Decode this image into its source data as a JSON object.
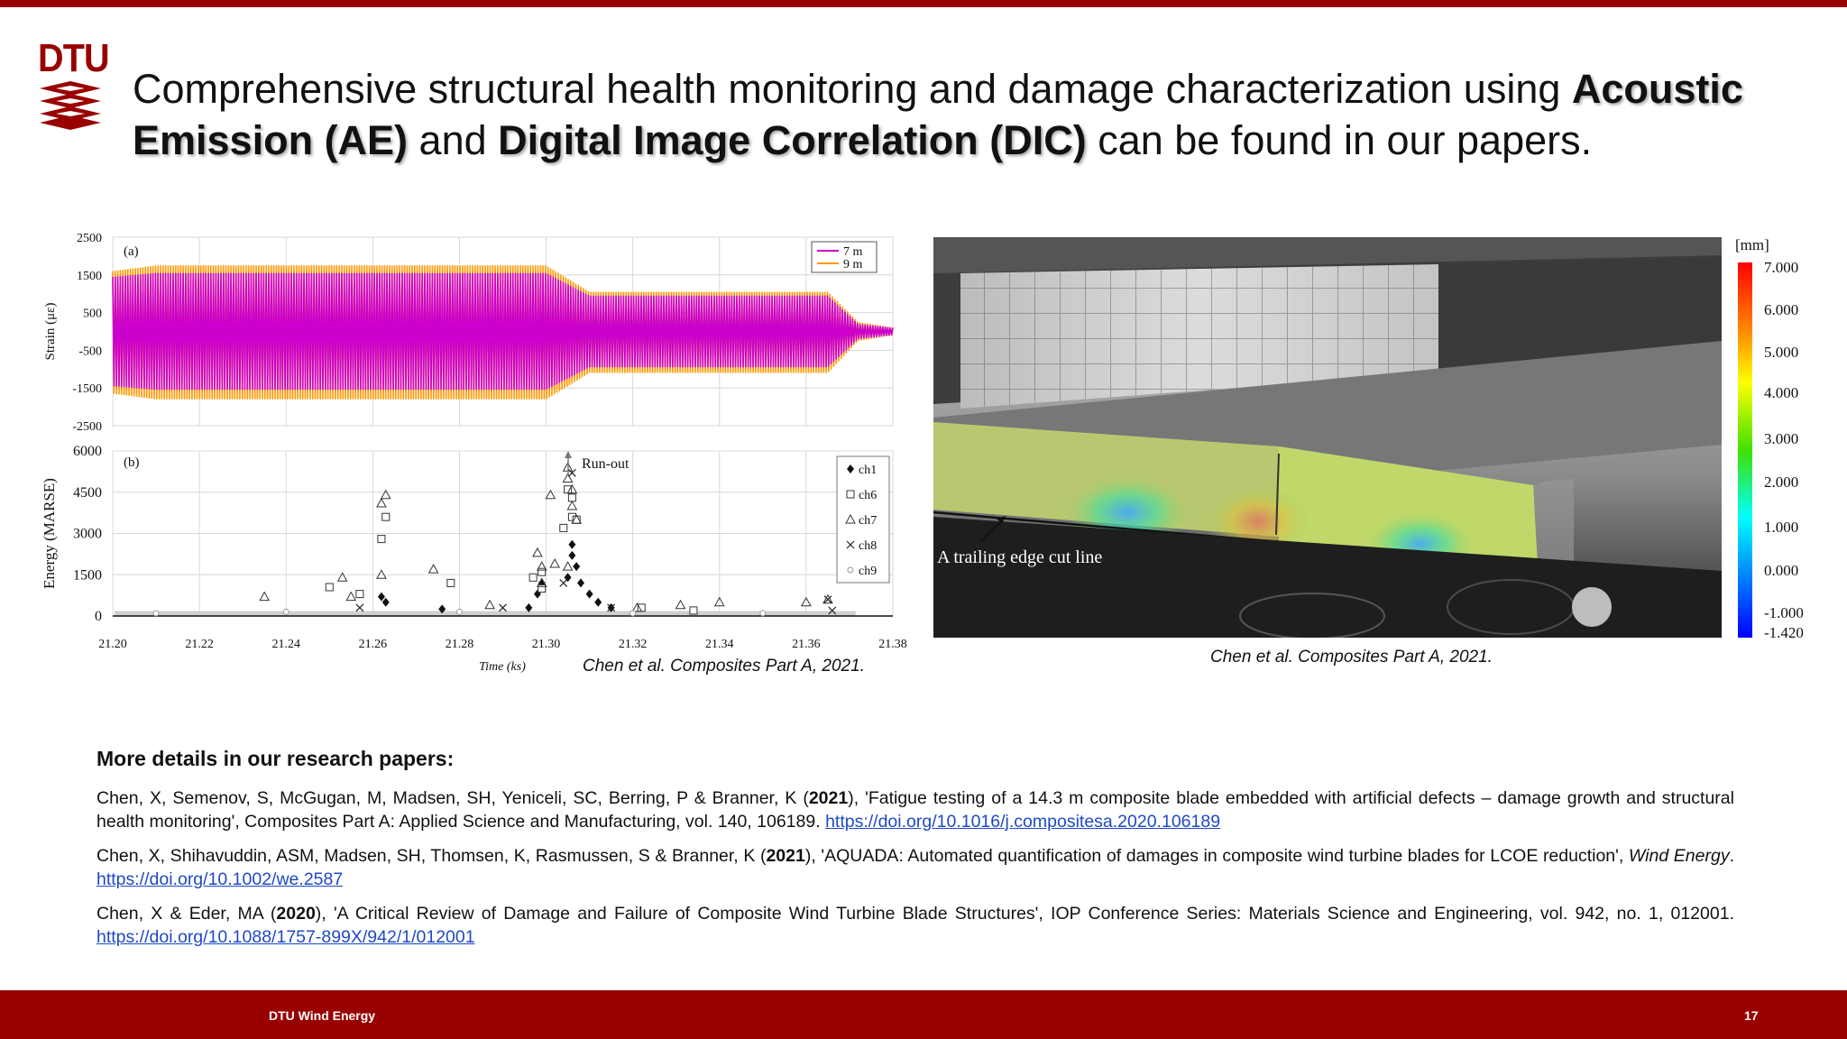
{
  "logo": {
    "text": "DTU"
  },
  "headline": {
    "part1": "Comprehensive structural health monitoring and damage characterization using ",
    "bold1": "Acoustic Emission (AE)",
    "part2": " and ",
    "bold2": "Digital Image Correlation (DIC)",
    "part3": " can be found in our papers."
  },
  "chart_data": [
    {
      "type": "area",
      "panel_label": "(a)",
      "xlabel": "",
      "ylabel": "Strain (με)",
      "ylim": [
        -2500,
        2500
      ],
      "y_ticks": [
        "2500",
        "1500",
        "500",
        "-500",
        "-1500",
        "-2500"
      ],
      "xlim": [
        21.2,
        21.38
      ],
      "grid": true,
      "legend": {
        "position": "top-right",
        "entries": [
          "7 m",
          "9 m"
        ]
      },
      "series": [
        {
          "name": "7 m",
          "color": "#cc00cc",
          "envelope": {
            "x": [
              21.2,
              21.21,
              21.3,
              21.31,
              21.365,
              21.372,
              21.38
            ],
            "ymax": [
              1450,
              1550,
              1550,
              950,
              950,
              200,
              100
            ],
            "ymin": [
              -1450,
              -1550,
              -1550,
              -950,
              -950,
              -200,
              -100
            ]
          }
        },
        {
          "name": "9 m",
          "color": "#ff9900",
          "envelope": {
            "x": [
              21.2,
              21.21,
              21.3,
              21.31,
              21.365,
              21.372,
              21.38
            ],
            "ymax": [
              1600,
              1750,
              1750,
              1050,
              1050,
              250,
              100
            ],
            "ymin": [
              -1650,
              -1800,
              -1800,
              -1100,
              -1100,
              -250,
              -100
            ]
          }
        }
      ]
    },
    {
      "type": "scatter",
      "panel_label": "(b)",
      "xlabel": "Time (ks)",
      "ylabel": "Energy (MARSE)",
      "ylim": [
        0,
        6000
      ],
      "y_ticks": [
        "6000",
        "4500",
        "3000",
        "1500",
        "0"
      ],
      "xlim": [
        21.2,
        21.38
      ],
      "x_ticks": [
        "21.20",
        "21.22",
        "21.24",
        "21.26",
        "21.28",
        "21.30",
        "21.32",
        "21.34",
        "21.36",
        "21.38"
      ],
      "grid": true,
      "annotation": "Run-out",
      "legend": {
        "position": "top-right",
        "entries": [
          "ch1",
          "ch6",
          "ch7",
          "ch8",
          "ch9"
        ]
      },
      "series": [
        {
          "name": "ch1",
          "marker": "filled-diamond",
          "points": [
            [
              21.262,
              700
            ],
            [
              21.263,
              500
            ],
            [
              21.276,
              250
            ],
            [
              21.296,
              300
            ],
            [
              21.298,
              800
            ],
            [
              21.299,
              1200
            ],
            [
              21.306,
              2600
            ],
            [
              21.306,
              2200
            ],
            [
              21.307,
              1800
            ],
            [
              21.305,
              1400
            ],
            [
              21.308,
              1200
            ],
            [
              21.31,
              800
            ],
            [
              21.312,
              500
            ],
            [
              21.315,
              300
            ]
          ]
        },
        {
          "name": "ch6",
          "marker": "open-square",
          "points": [
            [
              21.25,
              1050
            ],
            [
              21.257,
              800
            ],
            [
              21.262,
              2800
            ],
            [
              21.263,
              3600
            ],
            [
              21.278,
              1200
            ],
            [
              21.297,
              1400
            ],
            [
              21.299,
              1000
            ],
            [
              21.299,
              1600
            ],
            [
              21.304,
              3200
            ],
            [
              21.306,
              3600
            ],
            [
              21.306,
              4300
            ],
            [
              21.305,
              4600
            ],
            [
              21.307,
              3500
            ],
            [
              21.322,
              300
            ],
            [
              21.334,
              200
            ]
          ]
        },
        {
          "name": "ch7",
          "marker": "open-triangle",
          "points": [
            [
              21.235,
              700
            ],
            [
              21.253,
              1400
            ],
            [
              21.255,
              700
            ],
            [
              21.262,
              4100
            ],
            [
              21.263,
              4400
            ],
            [
              21.262,
              1500
            ],
            [
              21.274,
              1700
            ],
            [
              21.287,
              400
            ],
            [
              21.298,
              2300
            ],
            [
              21.299,
              1800
            ],
            [
              21.302,
              1900
            ],
            [
              21.299,
              1200
            ],
            [
              21.301,
              4400
            ],
            [
              21.305,
              5000
            ],
            [
              21.306,
              4600
            ],
            [
              21.306,
              4000
            ],
            [
              21.305,
              5400
            ],
            [
              21.307,
              3500
            ],
            [
              21.305,
              1800
            ],
            [
              21.321,
              300
            ],
            [
              21.331,
              400
            ],
            [
              21.34,
              500
            ],
            [
              21.36,
              500
            ],
            [
              21.365,
              600
            ]
          ]
        },
        {
          "name": "ch8",
          "marker": "x",
          "points": [
            [
              21.257,
              300
            ],
            [
              21.29,
              300
            ],
            [
              21.304,
              1200
            ],
            [
              21.306,
              5200
            ],
            [
              21.315,
              300
            ],
            [
              21.365,
              600
            ],
            [
              21.366,
              200
            ]
          ]
        },
        {
          "name": "ch9",
          "marker": "small-circle",
          "points": [
            [
              21.21,
              100
            ],
            [
              21.24,
              150
            ],
            [
              21.28,
              150
            ],
            [
              21.32,
              100
            ],
            [
              21.35,
              100
            ]
          ]
        }
      ]
    }
  ],
  "credit_left": "Chen et al. Composites Part A, 2021.",
  "dic": {
    "annotation": "A trailing edge cut line",
    "scale_unit": "[mm]",
    "scale_labels": [
      "7.000",
      "6.000",
      "5.000",
      "4.000",
      "3.000",
      "2.000",
      "1.000",
      "0.000",
      "-1.000",
      "-1.420"
    ]
  },
  "credit_right": "Chen et al. Composites Part A, 2021.",
  "refs": {
    "title": "More details in our research papers:",
    "r1_text": "Chen, X, Semenov, S, McGugan, M, Madsen, SH, Yeniceli, SC, Berring, P & Branner, K (",
    "r1_year": "2021",
    "r1_rest": "), 'Fatigue testing of a 14.3 m composite blade embedded with artificial defects – damage growth and structural health monitoring', Composites Part A: Applied Science and Manufacturing, vol. 140, 106189. ",
    "r1_link": "https://doi.org/10.1016/j.compositesa.2020.106189",
    "r2_text": "Chen, X, Shihavuddin, ASM, Madsen, SH, Thomsen, K, Rasmussen, S & Branner, K (",
    "r2_year": "2021",
    "r2_rest": "), 'AQUADA: Automated quantification of damages in composite wind turbine blades for LCOE reduction', ",
    "r2_journal": "Wind Energy",
    "r2_sep": ". ",
    "r2_link": "https://doi.org/10.1002/we.2587",
    "r3_text": "Chen, X & Eder, MA (",
    "r3_year": "2020",
    "r3_rest": "), 'A Critical Review of Damage and Failure of Composite Wind Turbine Blade Structures', IOP Conference Series: Materials Science and Engineering, vol. 942, no. 1, 012001. ",
    "r3_link": "https://doi.org/10.1088/1757-899X/942/1/012001"
  },
  "footer": {
    "left": "DTU Wind Energy",
    "page": "17"
  },
  "colors": {
    "brand": "#990000",
    "link": "#1f49c5"
  }
}
